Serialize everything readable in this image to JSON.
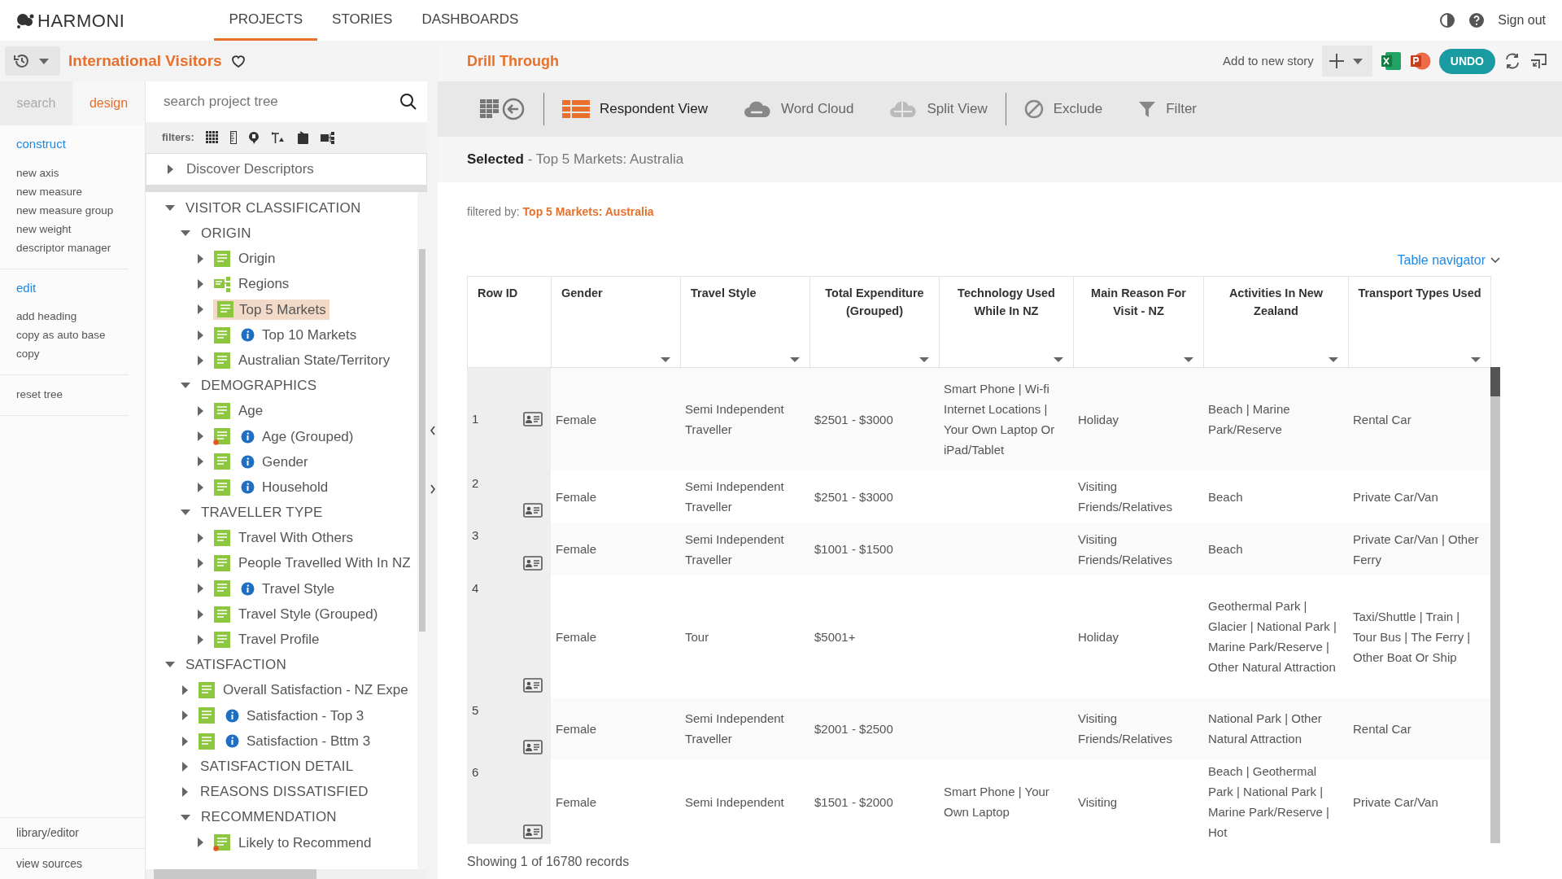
{
  "nav": {
    "logo": "HARMONI",
    "tabs": [
      {
        "label": "PROJECTS",
        "selected": true
      },
      {
        "label": "STORIES",
        "selected": false
      },
      {
        "label": "DASHBOARDS",
        "selected": false
      }
    ],
    "sign_out": "Sign out"
  },
  "project": {
    "title": "International Visitors"
  },
  "side_tabs": [
    {
      "label": "search",
      "selected": false
    },
    {
      "label": "design",
      "selected": true
    }
  ],
  "design_menu": [
    {
      "heading": "construct",
      "items": [
        "new axis",
        "new measure",
        "new measure group",
        "new weight",
        "descriptor manager"
      ]
    },
    {
      "heading": "edit",
      "items": [
        "add heading",
        "copy as auto base",
        "copy"
      ]
    },
    {
      "items": [
        "reset tree"
      ]
    }
  ],
  "design_footer": [
    "library/editor",
    "view sources"
  ],
  "tree_search": {
    "placeholder": "search project tree"
  },
  "filters_label": "filters:",
  "discover": "Discover Descriptors",
  "tree": [
    {
      "label": "VISITOR CLASSIFICATION",
      "kind": "group",
      "expanded": true,
      "children": [
        {
          "label": "ORIGIN",
          "kind": "group",
          "expanded": true,
          "children": [
            {
              "label": "Origin",
              "kind": "list",
              "expanded": false,
              "selected": false,
              "info": false,
              "flagged": false
            },
            {
              "label": "Regions",
              "kind": "hierarchy",
              "expanded": false,
              "selected": false,
              "info": false,
              "flagged": false
            },
            {
              "label": "Top 5 Markets",
              "kind": "list",
              "expanded": false,
              "selected": true,
              "info": false,
              "flagged": false
            },
            {
              "label": "Top 10 Markets",
              "kind": "list",
              "expanded": false,
              "selected": false,
              "info": true,
              "flagged": false
            },
            {
              "label": "Australian State/Territory",
              "kind": "list",
              "expanded": false,
              "selected": false,
              "info": false,
              "flagged": false
            }
          ]
        },
        {
          "label": "DEMOGRAPHICS",
          "kind": "group",
          "expanded": true,
          "children": [
            {
              "label": "Age",
              "kind": "list",
              "expanded": false,
              "selected": false,
              "info": false,
              "flagged": false
            },
            {
              "label": "Age (Grouped)",
              "kind": "list",
              "expanded": false,
              "selected": false,
              "info": true,
              "flagged": true
            },
            {
              "label": "Gender",
              "kind": "list",
              "expanded": false,
              "selected": false,
              "info": true,
              "flagged": false
            },
            {
              "label": "Household",
              "kind": "list",
              "expanded": false,
              "selected": false,
              "info": true,
              "flagged": false
            }
          ]
        },
        {
          "label": "TRAVELLER TYPE",
          "kind": "group",
          "expanded": true,
          "children": [
            {
              "label": "Travel With Others",
              "kind": "list",
              "expanded": false,
              "selected": false,
              "info": false,
              "flagged": false
            },
            {
              "label": "People Travelled With In NZ",
              "kind": "list",
              "expanded": false,
              "selected": false,
              "info": false,
              "flagged": false
            },
            {
              "label": "Travel Style",
              "kind": "list",
              "expanded": false,
              "selected": false,
              "info": true,
              "flagged": false
            },
            {
              "label": "Travel Style (Grouped)",
              "kind": "list",
              "expanded": false,
              "selected": false,
              "info": false,
              "flagged": false
            },
            {
              "label": "Travel Profile",
              "kind": "list",
              "expanded": false,
              "selected": false,
              "info": false,
              "flagged": false
            }
          ]
        }
      ]
    },
    {
      "label": "SATISFACTION",
      "kind": "group",
      "expanded": true,
      "children": [
        {
          "label": "Overall Satisfaction - NZ Expe",
          "kind": "list",
          "expanded": false,
          "selected": false,
          "info": false,
          "flagged": false
        },
        {
          "label": "Satisfaction - Top 3",
          "kind": "list",
          "expanded": false,
          "selected": false,
          "info": true,
          "flagged": false
        },
        {
          "label": "Satisfaction - Bttm 3",
          "kind": "list",
          "expanded": false,
          "selected": false,
          "info": true,
          "flagged": false
        },
        {
          "label": "SATISFACTION DETAIL",
          "kind": "group",
          "expanded": false
        },
        {
          "label": "REASONS DISSATISFIED",
          "kind": "group",
          "expanded": false
        },
        {
          "label": "RECOMMENDATION",
          "kind": "group",
          "expanded": true,
          "children": [
            {
              "label": "Likely to Recommend",
              "kind": "list",
              "expanded": false,
              "selected": false,
              "info": false,
              "flagged": true
            }
          ]
        }
      ]
    }
  ],
  "panel": {
    "title": "Drill Through",
    "add_to_story": "Add to new story",
    "undo": "UNDO"
  },
  "toolbar": [
    {
      "kind": "back"
    },
    {
      "kind": "respondent",
      "label": "Respondent View",
      "selected": true
    },
    {
      "kind": "cloud",
      "label": "Word Cloud",
      "selected": false
    },
    {
      "kind": "split",
      "label": "Split View",
      "selected": false
    },
    {
      "kind": "exclude",
      "label": "Exclude",
      "selected": false
    },
    {
      "kind": "filter",
      "label": "Filter",
      "selected": false
    }
  ],
  "selection": "**Selected** - Top 5 Markets: Australia",
  "filtered_by": {
    "label": "filtered by:",
    "value": "Top 5 Markets: Australia"
  },
  "table_navigator": "Table navigator",
  "table": {
    "columns": [
      "Row ID",
      "Gender",
      "Travel Style",
      "Total Expenditure (Grouped)",
      "Technology Used While In NZ",
      "Main Reason For Visit - NZ",
      "Activities In New Zealand",
      "Transport Types Used"
    ],
    "rows": [
      {
        "cells": [
          "1",
          "Female",
          "Semi Independent Traveller",
          "$2501 - $3000",
          "Smart Phone | Wi-fi Internet Locations | Your Own Laptop Or iPad/Tablet",
          "Holiday",
          "Beach | Marine Park/Reserve",
          "Rental Car"
        ]
      },
      {
        "cells": [
          "2",
          "Female",
          "Semi Independent Traveller",
          "$2501 - $3000",
          null,
          "Visiting Friends/Relatives",
          "Beach",
          "Private Car/Van"
        ]
      },
      {
        "cells": [
          "3",
          "Female",
          "Semi Independent Traveller",
          "$1001 - $1500",
          null,
          "Visiting Friends/Relatives",
          "Beach",
          "Private Car/Van | Other Ferry"
        ]
      },
      {
        "cells": [
          "4",
          "Female",
          "Tour",
          "$5001+",
          null,
          "Holiday",
          "Geothermal Park | Glacier | National Park | Marine Park/Reserve | Other Natural Attraction",
          "Taxi/Shuttle | Train | Tour Bus | The Ferry | Other Boat Or Ship"
        ]
      },
      {
        "cells": [
          "5",
          "Female",
          "Semi Independent Traveller",
          "$2001 - $2500",
          null,
          "Visiting Friends/Relatives",
          "National Park | Other Natural Attraction",
          "Rental Car"
        ]
      },
      {
        "cells": [
          "6",
          "Female",
          "Semi Independent",
          "$1501 - $2000",
          "Smart Phone | Your Own Laptop",
          "Visiting",
          "Beach | Geothermal Park | National Park | Marine Park/Reserve | Hot",
          "Private Car/Van"
        ]
      }
    ]
  },
  "status": "Showing 1 of 16780 records"
}
